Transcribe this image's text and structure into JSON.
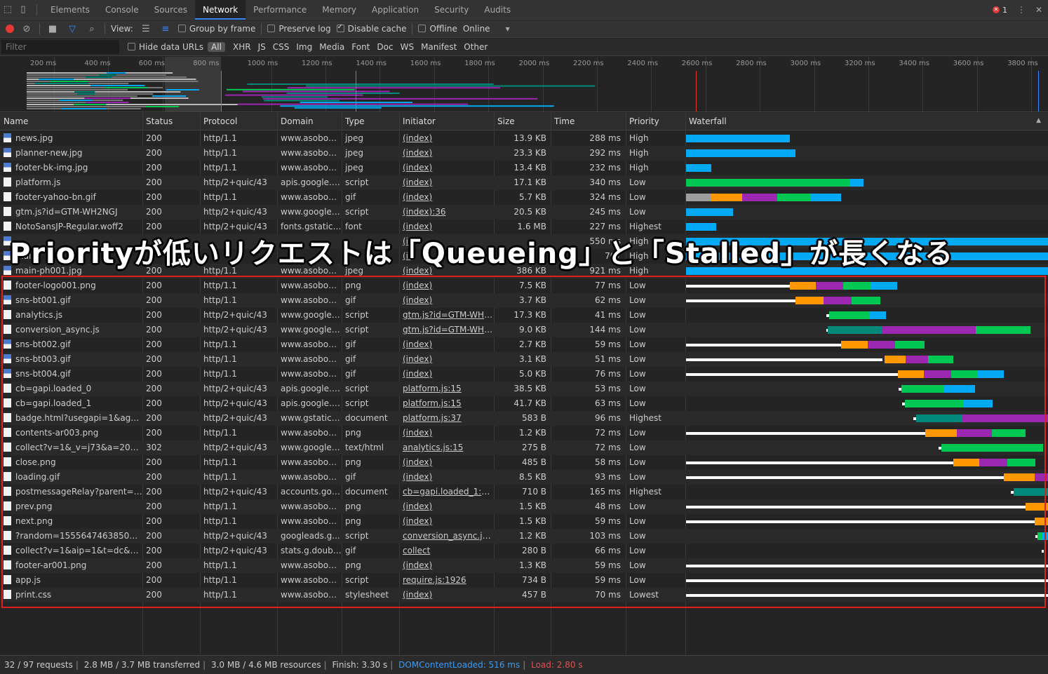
{
  "tabs": [
    "Elements",
    "Console",
    "Sources",
    "Network",
    "Performance",
    "Memory",
    "Application",
    "Security",
    "Audits"
  ],
  "active_tab": "Network",
  "error_count": "1",
  "toolbar": {
    "view_label": "View:",
    "group_by_frame": "Group by frame",
    "preserve_log": "Preserve log",
    "disable_cache": "Disable cache",
    "offline": "Offline",
    "throttle": "Online"
  },
  "filterbar": {
    "placeholder": "Filter",
    "hide_data_urls": "Hide data URLs",
    "types": [
      "All",
      "XHR",
      "JS",
      "CSS",
      "Img",
      "Media",
      "Font",
      "Doc",
      "WS",
      "Manifest",
      "Other"
    ]
  },
  "overview_ticks": [
    "200 ms",
    "400 ms",
    "600 ms",
    "800 ms",
    "1000 ms",
    "1200 ms",
    "1400 ms",
    "1600 ms",
    "1800 ms",
    "2000 ms",
    "2200 ms",
    "2400 ms",
    "2600 ms",
    "2800 ms",
    "3000 ms",
    "3200 ms",
    "3400 ms",
    "3600 ms",
    "3800 ms"
  ],
  "columns": [
    "Name",
    "Status",
    "Protocol",
    "Domain",
    "Type",
    "Initiator",
    "Size",
    "Time",
    "Priority",
    "Waterfall"
  ],
  "rows": [
    {
      "name": "news.jpg",
      "icon": "img",
      "status": "200",
      "protocol": "http/1.1",
      "domain": "www.asobou....",
      "type": "jpeg",
      "initiator": "(index)",
      "size": "13.9 KB",
      "time": "288 ms",
      "priority": "High"
    },
    {
      "name": "planner-new.jpg",
      "icon": "img",
      "status": "200",
      "protocol": "http/1.1",
      "domain": "www.asobou....",
      "type": "jpeg",
      "initiator": "(index)",
      "size": "23.3 KB",
      "time": "292 ms",
      "priority": "High"
    },
    {
      "name": "footer-bk-img.jpg",
      "icon": "img",
      "status": "200",
      "protocol": "http/1.1",
      "domain": "www.asobou....",
      "type": "jpeg",
      "initiator": "(index)",
      "size": "13.4 KB",
      "time": "232 ms",
      "priority": "High"
    },
    {
      "name": "platform.js",
      "icon": "doc",
      "status": "200",
      "protocol": "http/2+quic/43",
      "domain": "apis.google.c...",
      "type": "script",
      "initiator": "(index)",
      "size": "17.1 KB",
      "time": "340 ms",
      "priority": "Low"
    },
    {
      "name": "footer-yahoo-bn.gif",
      "icon": "doc",
      "status": "200",
      "protocol": "http/1.1",
      "domain": "www.asobou....",
      "type": "gif",
      "initiator": "(index)",
      "size": "5.7 KB",
      "time": "324 ms",
      "priority": "Low"
    },
    {
      "name": "gtm.js?id=GTM-WH2NGJ",
      "icon": "doc",
      "status": "200",
      "protocol": "http/2+quic/43",
      "domain": "www.googlet...",
      "type": "script",
      "initiator": "(index):36",
      "size": "20.5 KB",
      "time": "245 ms",
      "priority": "Low"
    },
    {
      "name": "NotoSansJP-Regular.woff2",
      "icon": "doc",
      "status": "200",
      "protocol": "http/2+quic/43",
      "domain": "fonts.gstatic.c...",
      "type": "font",
      "initiator": "(index)",
      "size": "1.6 MB",
      "time": "227 ms",
      "priority": "Highest"
    },
    {
      "name": "",
      "icon": "img",
      "status": "",
      "protocol": "",
      "domain": "",
      "type": "",
      "initiator": "(in",
      "size": "",
      "time": "550 ms",
      "priority": "High"
    },
    {
      "name": "main",
      "icon": "img",
      "status": "",
      "protocol": "",
      "domain": "",
      "type": "",
      "initiator": "(in",
      "size": "",
      "time": "767",
      "priority": "High"
    },
    {
      "name": "main-ph001.jpg",
      "icon": "img",
      "status": "200",
      "protocol": "http/1.1",
      "domain": "www.asobou....",
      "type": "jpeg",
      "initiator": "(index)",
      "size": "386 KB",
      "time": "921 ms",
      "priority": "High"
    },
    {
      "name": "footer-logo001.png",
      "icon": "doc",
      "status": "200",
      "protocol": "http/1.1",
      "domain": "www.asobou....",
      "type": "png",
      "initiator": "(index)",
      "size": "7.5 KB",
      "time": "77 ms",
      "priority": "Low"
    },
    {
      "name": "sns-bt001.gif",
      "icon": "img",
      "status": "200",
      "protocol": "http/1.1",
      "domain": "www.asobou....",
      "type": "gif",
      "initiator": "(index)",
      "size": "3.7 KB",
      "time": "62 ms",
      "priority": "Low"
    },
    {
      "name": "analytics.js",
      "icon": "doc",
      "status": "200",
      "protocol": "http/2+quic/43",
      "domain": "www.google-...",
      "type": "script",
      "initiator": "gtm.js?id=GTM-WH2...",
      "size": "17.3 KB",
      "time": "41 ms",
      "priority": "Low"
    },
    {
      "name": "conversion_async.js",
      "icon": "doc",
      "status": "200",
      "protocol": "http/2+quic/43",
      "domain": "www.googlea...",
      "type": "script",
      "initiator": "gtm.js?id=GTM-WH2...",
      "size": "9.0 KB",
      "time": "144 ms",
      "priority": "Low"
    },
    {
      "name": "sns-bt002.gif",
      "icon": "img",
      "status": "200",
      "protocol": "http/1.1",
      "domain": "www.asobou....",
      "type": "gif",
      "initiator": "(index)",
      "size": "2.7 KB",
      "time": "59 ms",
      "priority": "Low"
    },
    {
      "name": "sns-bt003.gif",
      "icon": "img",
      "status": "200",
      "protocol": "http/1.1",
      "domain": "www.asobou....",
      "type": "gif",
      "initiator": "(index)",
      "size": "3.1 KB",
      "time": "51 ms",
      "priority": "Low"
    },
    {
      "name": "sns-bt004.gif",
      "icon": "img",
      "status": "200",
      "protocol": "http/1.1",
      "domain": "www.asobou....",
      "type": "gif",
      "initiator": "(index)",
      "size": "5.0 KB",
      "time": "76 ms",
      "priority": "Low"
    },
    {
      "name": "cb=gapi.loaded_0",
      "icon": "doc",
      "status": "200",
      "protocol": "http/2+quic/43",
      "domain": "apis.google.c...",
      "type": "script",
      "initiator": "platform.js:15",
      "size": "38.5 KB",
      "time": "53 ms",
      "priority": "Low"
    },
    {
      "name": "cb=gapi.loaded_1",
      "icon": "doc",
      "status": "200",
      "protocol": "http/2+quic/43",
      "domain": "apis.google.c...",
      "type": "script",
      "initiator": "platform.js:15",
      "size": "41.7 KB",
      "time": "63 ms",
      "priority": "Low"
    },
    {
      "name": "badge.html?usegapi=1&agenc...",
      "icon": "doc",
      "status": "200",
      "protocol": "http/2+quic/43",
      "domain": "www.gstatic.c...",
      "type": "document",
      "initiator": "platform.js:37",
      "size": "583 B",
      "time": "96 ms",
      "priority": "Highest"
    },
    {
      "name": "contents-ar003.png",
      "icon": "doc",
      "status": "200",
      "protocol": "http/1.1",
      "domain": "www.asobou....",
      "type": "png",
      "initiator": "(index)",
      "size": "1.2 KB",
      "time": "72 ms",
      "priority": "Low"
    },
    {
      "name": "collect?v=1&_v=j73&a=20845...",
      "icon": "doc",
      "status": "302",
      "protocol": "http/2+quic/43",
      "domain": "www.google-...",
      "type": "text/html",
      "initiator": "analytics.js:15",
      "size": "275 B",
      "time": "72 ms",
      "priority": "Low"
    },
    {
      "name": "close.png",
      "icon": "doc",
      "status": "200",
      "protocol": "http/1.1",
      "domain": "www.asobou....",
      "type": "png",
      "initiator": "(index)",
      "size": "485 B",
      "time": "58 ms",
      "priority": "Low"
    },
    {
      "name": "loading.gif",
      "icon": "doc",
      "status": "200",
      "protocol": "http/1.1",
      "domain": "www.asobou....",
      "type": "gif",
      "initiator": "(index)",
      "size": "8.5 KB",
      "time": "93 ms",
      "priority": "Low"
    },
    {
      "name": "postmessageRelay?parent=htt...",
      "icon": "doc",
      "status": "200",
      "protocol": "http/2+quic/43",
      "domain": "accounts.goo...",
      "type": "document",
      "initiator": "cb=gapi.loaded_1:291",
      "size": "710 B",
      "time": "165 ms",
      "priority": "Highest"
    },
    {
      "name": "prev.png",
      "icon": "doc",
      "status": "200",
      "protocol": "http/1.1",
      "domain": "www.asobou....",
      "type": "png",
      "initiator": "(index)",
      "size": "1.5 KB",
      "time": "48 ms",
      "priority": "Low"
    },
    {
      "name": "next.png",
      "icon": "doc",
      "status": "200",
      "protocol": "http/1.1",
      "domain": "www.asobou....",
      "type": "png",
      "initiator": "(index)",
      "size": "1.5 KB",
      "time": "59 ms",
      "priority": "Low"
    },
    {
      "name": "?random=1555647463850&cv...",
      "icon": "doc",
      "status": "200",
      "protocol": "http/2+quic/43",
      "domain": "googleads.g...",
      "type": "script",
      "initiator": "conversion_async.js:17",
      "size": "1.2 KB",
      "time": "103 ms",
      "priority": "Low"
    },
    {
      "name": "collect?v=1&aip=1&t=dc&_r=...",
      "icon": "doc",
      "status": "200",
      "protocol": "http/2+quic/43",
      "domain": "stats.g.double...",
      "type": "gif",
      "initiator": "collect",
      "size": "280 B",
      "time": "66 ms",
      "priority": "Low"
    },
    {
      "name": "footer-ar001.png",
      "icon": "doc",
      "status": "200",
      "protocol": "http/1.1",
      "domain": "www.asobou....",
      "type": "png",
      "initiator": "(index)",
      "size": "1.3 KB",
      "time": "59 ms",
      "priority": "Low"
    },
    {
      "name": "app.js",
      "icon": "doc",
      "status": "200",
      "protocol": "http/1.1",
      "domain": "www.asobou....",
      "type": "script",
      "initiator": "require.js:1926",
      "size": "734 B",
      "time": "59 ms",
      "priority": "Low"
    },
    {
      "name": "print.css",
      "icon": "doc",
      "status": "200",
      "protocol": "http/1.1",
      "domain": "www.asobou....",
      "type": "stylesheet",
      "initiator": "(index)",
      "size": "457 B",
      "time": "70 ms",
      "priority": "Lowest"
    }
  ],
  "caption": "Priorityが低いリクエストは「Queueing」と「Stalled」が長くなる",
  "status": {
    "requests": "32 / 97 requests",
    "transferred": "2.8 MB / 3.7 MB transferred",
    "resources": "3.0 MB / 4.6 MB resources",
    "finish": "Finish: 3.30 s",
    "dom_content_loaded": "DOMContentLoaded: 516 ms",
    "load": "Load: 2.80 s"
  },
  "colors": {
    "queueing": "#ffffff",
    "stalled": "#9e9e9e",
    "ssl": "#ff9800",
    "request_sent": "#9c27b0",
    "waiting": "#00c853",
    "download": "#03a9f4",
    "connect": "#00897b",
    "highlight": "#e0201a"
  }
}
